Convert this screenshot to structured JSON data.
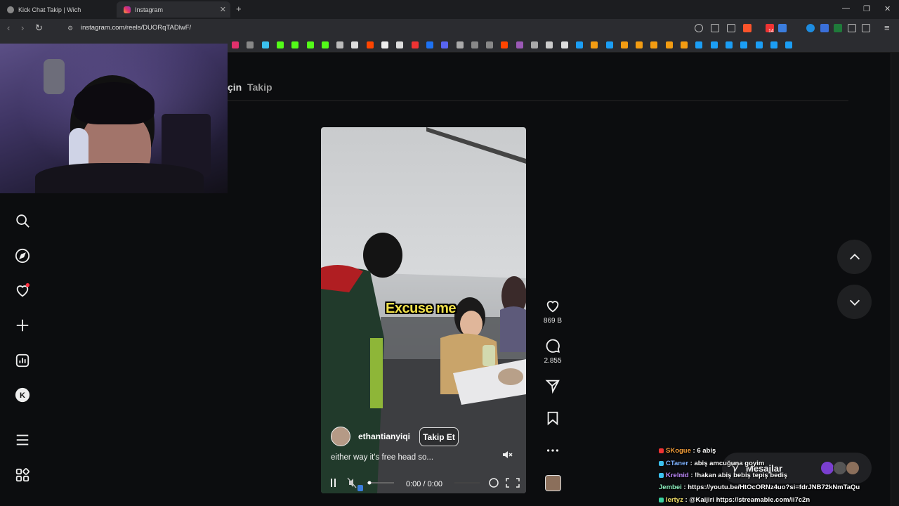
{
  "browser": {
    "tabs": [
      {
        "title": "Kick Chat Takip | Wich",
        "active": false
      },
      {
        "title": "Instagram",
        "active": true
      }
    ],
    "url": "instagram.com/reels/DUORqTADlwF/",
    "bookmark_badge": "14"
  },
  "feed_tabs": {
    "for_you": "çin",
    "following": "Takip"
  },
  "sidebar": {
    "items": [
      "search-icon",
      "explore-icon",
      "notifications-icon",
      "create-icon",
      "insights-icon",
      "kick-icon",
      "menu-icon",
      "apps-icon"
    ]
  },
  "reel": {
    "overlay_text": "Excuse me",
    "author": "ethantianyiqi",
    "follow_label": "Takip Et",
    "caption": "either way it's free head so...",
    "time": "0:00 / 0:00"
  },
  "actions": {
    "likes": "869 B",
    "comments": "2.855"
  },
  "messages": {
    "label": "Mesajlar"
  },
  "chat": [
    {
      "user": "SKogue",
      "text": ": 6 abiş",
      "color": "#f7a03a"
    },
    {
      "user": "CTaner",
      "text": ": abiş amcuğuna goyim",
      "color": "#7fb2ff"
    },
    {
      "user": "Krelnid",
      "text": ": !hakan abiş bebiş tepiş bediş",
      "color": "#c08bff"
    },
    {
      "user": "Jembei",
      "text": ": https://youtu.be/HtOcORNz4uo?si=fdrJNB72kNmTaQu",
      "color": "#8ef0c0"
    },
    {
      "user": "lertyz",
      "text": ": @Kaijiri https://streamable.com/ii7c2n",
      "color": "#f6e36a"
    }
  ],
  "colors": {
    "page_bg": "#0c0d0f",
    "overlay_yellow": "#f2e14a",
    "notification_dot": "#ff3040"
  }
}
